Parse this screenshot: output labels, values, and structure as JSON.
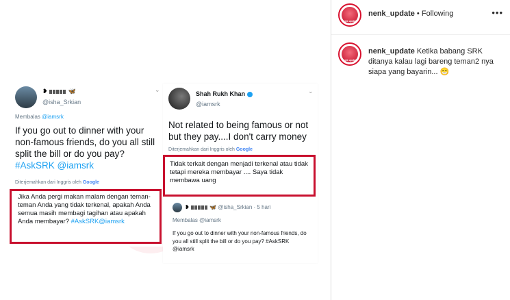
{
  "header": {
    "username": "nenk_update",
    "separator": "•",
    "following": "Following",
    "more": "•••"
  },
  "caption": {
    "username": "nenk_update",
    "text": "Ketika babang SRK ditanya kalau lagi bareng teman2 nya siapa yang bayarin...",
    "emoji": "😁"
  },
  "tweet_left": {
    "name_glyph": "❥",
    "name_suffix": "🦋",
    "handle": "@isha_Srkian",
    "reply_prefix": "Membalas",
    "reply_to": "@iamsrk",
    "text": "If you go out to dinner with your non-famous friends, do you all still split the bill or do you pay?",
    "hashtag": "#AskSRK",
    "mention": "@iamsrk",
    "translated_from": "Diterjemahkan dari Inggris oleh",
    "google": "Google",
    "translation": "Jika Anda pergi makan malam dengan teman-teman Anda yang tidak terkenal, apakah Anda semua masih membagi tagihan atau apakah Anda membayar?",
    "translation_tag": "#AskSRK@iamsrk"
  },
  "tweet_right": {
    "name": "Shah Rukh Khan",
    "handle": "@iamsrk",
    "text": "Not related to being famous or not but they pay....I don't carry money",
    "translated_from": "Diterjemahkan dari Inggris oleh",
    "google": "Google",
    "translation": "Tidak terkait dengan menjadi terkenal atau tidak tetapi mereka membayar .... Saya tidak membawa uang",
    "quoted": {
      "name_glyph": "❥",
      "name_suffix": "🦋",
      "handle": "@isha_Srkian",
      "time": "· 5 hari",
      "reply_prefix": "Membalas",
      "reply_to": "@iamsrk",
      "text": "If you go out to dinner with your non-famous friends, do you all still split the bill or do you pay? #AskSRK @iamsrk"
    }
  },
  "avatar_text": "nenk update",
  "colors": {
    "accent": "#c8102e",
    "link": "#1da1f2"
  }
}
